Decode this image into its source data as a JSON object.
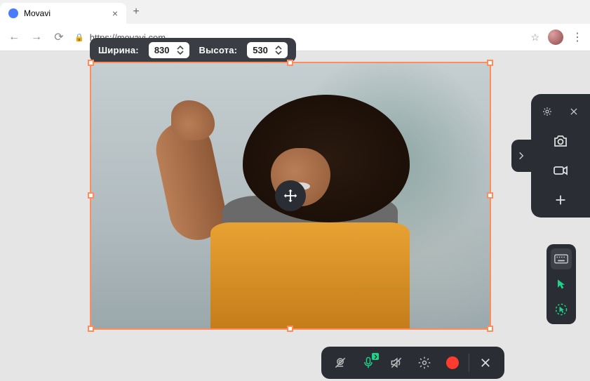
{
  "browser": {
    "tab_title": "Movavi",
    "url": "https://movavi.com"
  },
  "dimensions": {
    "width_label": "Ширина:",
    "width_value": "830",
    "height_label": "Высота:",
    "height_value": "530"
  },
  "colors": {
    "selection_border": "#ff8c5a",
    "accent_green": "#1fd28a",
    "record_red": "#ff3b30",
    "panel_bg": "#2a2d34"
  }
}
